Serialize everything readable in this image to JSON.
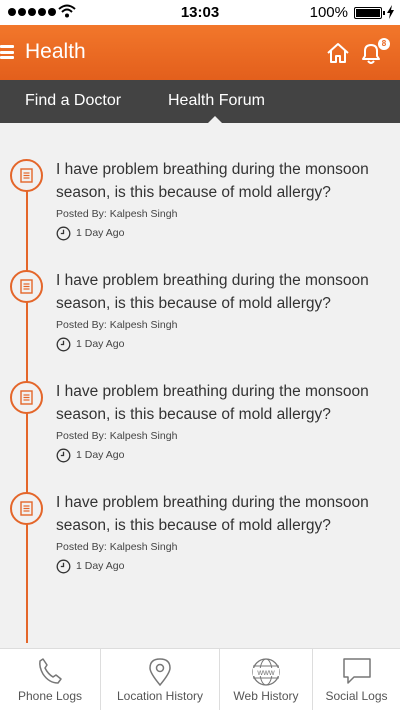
{
  "status_bar": {
    "time": "13:03",
    "battery": "100%",
    "signal_icon": "signal-dots-icon",
    "wifi_icon": "wifi-icon",
    "battery_icon": "battery-icon",
    "charging_icon": "lightning-bolt-icon"
  },
  "header": {
    "title": "Health",
    "menu_icon": "hamburger-menu-icon",
    "home_icon": "home-icon",
    "bell_icon": "bell-icon",
    "notification_count": "8"
  },
  "tabs": [
    {
      "label": "Find a Doctor",
      "active": false
    },
    {
      "label": "Health Forum",
      "active": true
    }
  ],
  "posts": [
    {
      "question": "I have problem breathing during the monsoon season, is this because of mold allergy?",
      "posted_by": "Posted By: Kalpesh Singh",
      "time": "1 Day Ago",
      "icon": "document-icon"
    },
    {
      "question": "I have problem breathing during the monsoon season, is this because of mold allergy?",
      "posted_by": "Posted By: Kalpesh Singh",
      "time": "1 Day Ago",
      "icon": "document-icon"
    },
    {
      "question": "I have problem breathing during the monsoon season, is this because of mold allergy?",
      "posted_by": "Posted By: Kalpesh Singh",
      "time": "1 Day Ago",
      "icon": "document-icon"
    },
    {
      "question": "I have problem breathing during the monsoon season, is this because of mold allergy?",
      "posted_by": "Posted By: Kalpesh Singh",
      "time": "1 Day Ago",
      "icon": "document-icon"
    }
  ],
  "bottom_nav": [
    {
      "label": "Phone Logs",
      "icon": "phone-icon"
    },
    {
      "label": "Location History",
      "icon": "location-pin-icon"
    },
    {
      "label": "Web History",
      "icon": "globe-www-icon"
    },
    {
      "label": "Social Logs",
      "icon": "chat-bubble-icon"
    }
  ],
  "colors": {
    "accent": "#e4662a",
    "header_top": "#f2772b",
    "header_bottom": "#e35f1c",
    "tab_bar": "#434343",
    "background": "#f1f1f1"
  }
}
